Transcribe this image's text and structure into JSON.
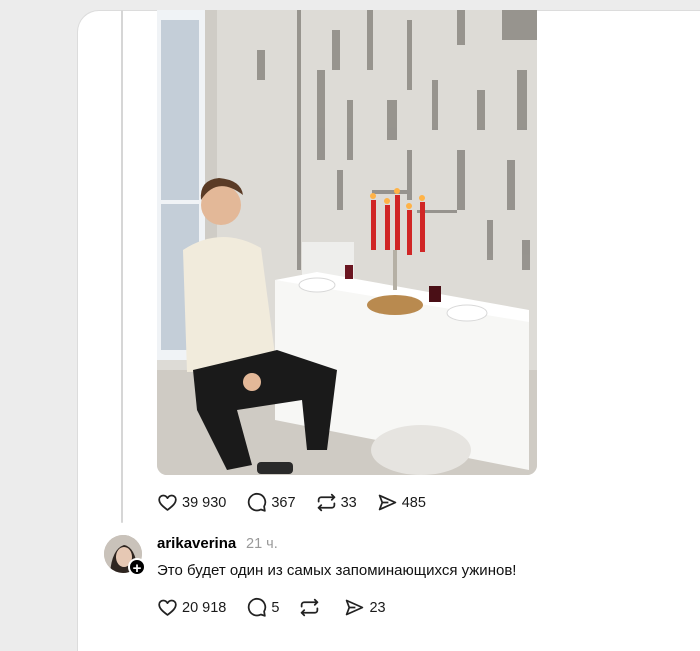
{
  "post": {
    "image_alt": "photo",
    "likes": "39 930",
    "comments": "367",
    "reposts": "33",
    "shares": "485"
  },
  "reply": {
    "username": "arikaverina",
    "time": "21 ч.",
    "text": "Это будет один из самых запоминающихся ужинов!",
    "likes": "20 918",
    "comments": "5",
    "reposts": "",
    "shares": "23"
  },
  "icons": {
    "like": "heart-icon",
    "comment": "comment-icon",
    "repost": "repost-icon",
    "share": "send-icon",
    "follow": "plus-icon"
  }
}
